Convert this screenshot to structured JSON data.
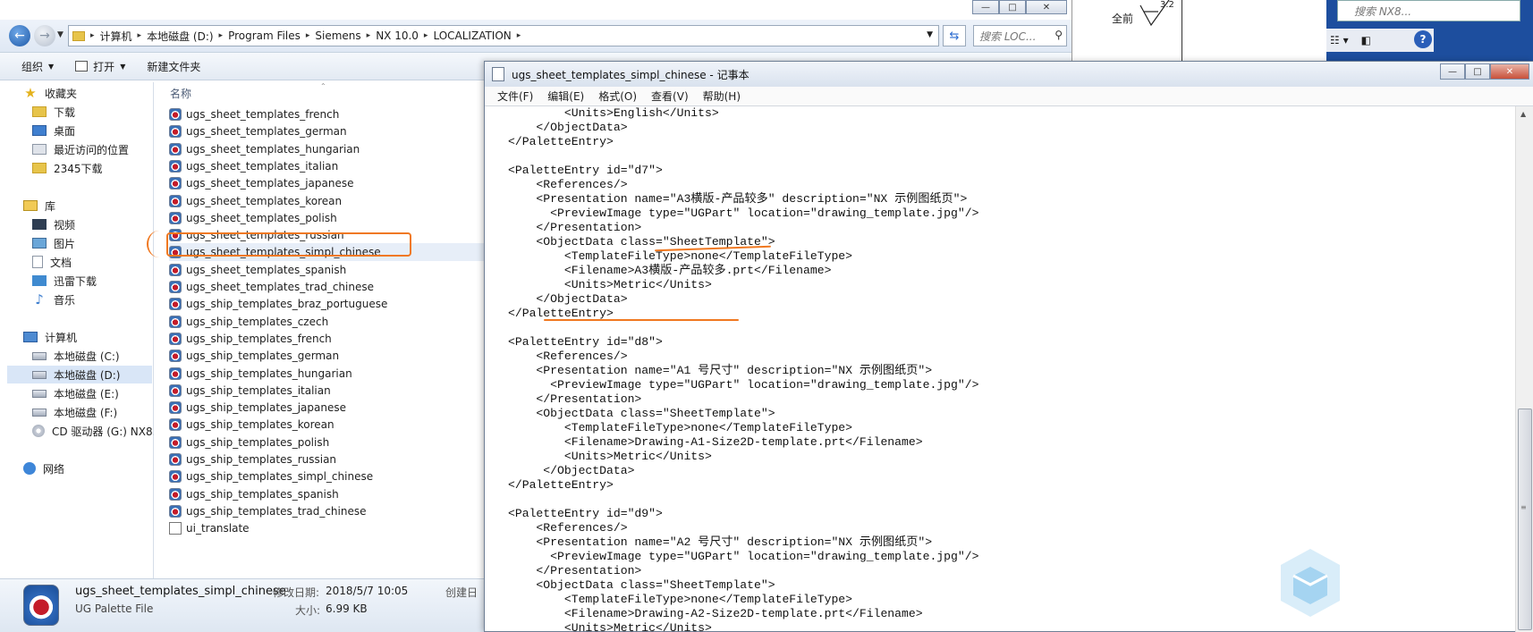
{
  "background": {
    "drawing_label": "全前",
    "drawing_number": "3.2",
    "nx_search_placeholder": "搜索 NX8...",
    "help_icon": "?"
  },
  "explorer": {
    "window_buttons": [
      "—",
      "□",
      "✕"
    ],
    "address_path": [
      "计算机",
      "本地磁盘 (D:)",
      "Program Files",
      "Siemens",
      "NX 10.0",
      "LOCALIZATION"
    ],
    "search_placeholder": "搜索 LOC...",
    "commands": {
      "organize": "组织",
      "open": "打开",
      "new_folder": "新建文件夹"
    },
    "column_name": "名称",
    "nav": {
      "favorites": "收藏夹",
      "downloads": "下载",
      "desktop": "桌面",
      "recent": "最近访问的位置",
      "downloads2345": "2345下载",
      "libraries": "库",
      "videos": "视频",
      "pictures": "图片",
      "documents": "文档",
      "thunder": "迅雷下载",
      "music": "音乐",
      "computer": "计算机",
      "drive_c": "本地磁盘 (C:)",
      "drive_d": "本地磁盘 (D:)",
      "drive_e": "本地磁盘 (E:)",
      "drive_f": "本地磁盘 (F:)",
      "drive_g": "CD 驱动器 (G:) NX8.",
      "network": "网络"
    },
    "files": [
      "ugs_sheet_templates_french",
      "ugs_sheet_templates_german",
      "ugs_sheet_templates_hungarian",
      "ugs_sheet_templates_italian",
      "ugs_sheet_templates_japanese",
      "ugs_sheet_templates_korean",
      "ugs_sheet_templates_polish",
      "ugs_sheet_templates_russian",
      "ugs_sheet_templates_simpl_chinese",
      "ugs_sheet_templates_spanish",
      "ugs_sheet_templates_trad_chinese",
      "ugs_ship_templates_braz_portuguese",
      "ugs_ship_templates_czech",
      "ugs_ship_templates_french",
      "ugs_ship_templates_german",
      "ugs_ship_templates_hungarian",
      "ugs_ship_templates_italian",
      "ugs_ship_templates_japanese",
      "ugs_ship_templates_korean",
      "ugs_ship_templates_polish",
      "ugs_ship_templates_russian",
      "ugs_ship_templates_simpl_chinese",
      "ugs_ship_templates_spanish",
      "ugs_ship_templates_trad_chinese",
      "ui_translate"
    ],
    "selected_file": "ugs_sheet_templates_simpl_chinese",
    "details": {
      "name": "ugs_sheet_templates_simpl_chinese",
      "type": "UG Palette File",
      "modified_label": "修改日期:",
      "modified_value": "2018/5/7 10:05",
      "size_label": "大小:",
      "size_value": "6.99 KB",
      "created_label": "创建日"
    }
  },
  "notepad": {
    "title": "ugs_sheet_templates_simpl_chinese - 记事本",
    "window_buttons": [
      "—",
      "□",
      "✕"
    ],
    "menu": [
      "文件(F)",
      "编辑(E)",
      "格式(O)",
      "查看(V)",
      "帮助(H)"
    ],
    "content": "        <Units>English</Units>\n    </ObjectData>\n</PaletteEntry>\n\n<PaletteEntry id=\"d7\">\n    <References/>\n    <Presentation name=\"A3横版-产品较多\" description=\"NX 示例图纸页\">\n      <PreviewImage type=\"UGPart\" location=\"drawing_template.jpg\"/>\n    </Presentation>\n    <ObjectData class=\"SheetTemplate\">\n        <TemplateFileType>none</TemplateFileType>\n        <Filename>A3横版-产品较多.prt</Filename>\n        <Units>Metric</Units>\n    </ObjectData>\n</PaletteEntry>\n\n<PaletteEntry id=\"d8\">\n    <References/>\n    <Presentation name=\"A1 号尺寸\" description=\"NX 示例图纸页\">\n      <PreviewImage type=\"UGPart\" location=\"drawing_template.jpg\"/>\n    </Presentation>\n    <ObjectData class=\"SheetTemplate\">\n        <TemplateFileType>none</TemplateFileType>\n        <Filename>Drawing-A1-Size2D-template.prt</Filename>\n        <Units>Metric</Units>\n     </ObjectData>\n</PaletteEntry>\n\n<PaletteEntry id=\"d9\">\n    <References/>\n    <Presentation name=\"A2 号尺寸\" description=\"NX 示例图纸页\">\n      <PreviewImage type=\"UGPart\" location=\"drawing_template.jpg\"/>\n    </Presentation>\n    <ObjectData class=\"SheetTemplate\">\n        <TemplateFileType>none</TemplateFileType>\n        <Filename>Drawing-A2-Size2D-template.prt</Filename>\n        <Units>Metric</Units>"
  },
  "colors": {
    "annotation": "#f07820",
    "nx_blue": "#1d4e9e",
    "selection": "#e7eef8"
  },
  "icons": [
    "folder-icon",
    "star-icon",
    "drive-icon",
    "cd-icon",
    "network-icon",
    "ug-palette-file-icon",
    "text-file-icon",
    "search-icon",
    "refresh-icon",
    "watermark-logo"
  ]
}
